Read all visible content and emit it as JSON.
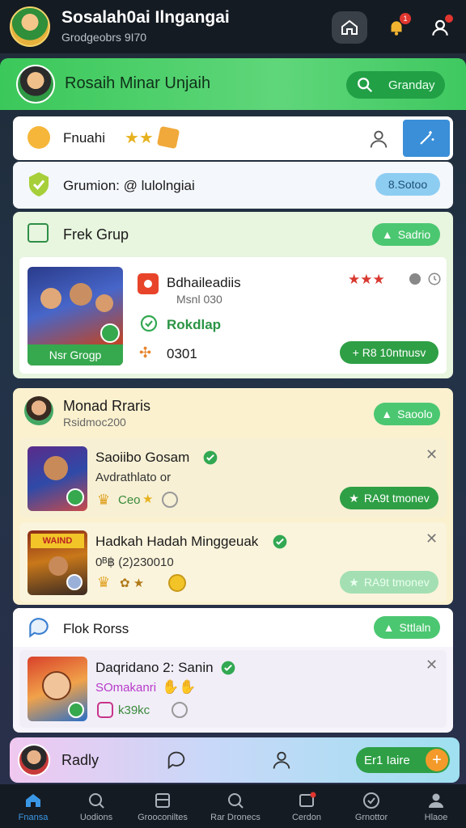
{
  "topbar": {
    "title": "Sosalah0ai Ilngangai",
    "subtitle": "Grodgeobrs 9I70",
    "badge_count": "1"
  },
  "header": {
    "title": "Rosaih Minar Unjaih",
    "button_label": "Granday"
  },
  "card_fnuahi": {
    "label": "Fnuahi"
  },
  "card_grumion": {
    "label": "Grumion: @ lulolngiai",
    "button": "8.Sotoo"
  },
  "frek_grup": {
    "title": "Frek Grup",
    "button": "Sadrio",
    "item": {
      "name": "Bdhaileadiis",
      "meta": "Msnl 030",
      "status": "Rokdlap",
      "count": "0301",
      "thumb_label": "Nsr Grogp",
      "action": "+ R8 10ntnusv"
    }
  },
  "monad": {
    "title": "Monad Rraris",
    "subtitle": "Rsidmoc200",
    "button": "Saoolo",
    "items": [
      {
        "name": "Saoiibo Gosam",
        "meta": "Avdrathlato or",
        "tag": "Ceo",
        "action": "RA9t tmonev"
      },
      {
        "name": "Hadkah Hadah Minggeuak",
        "meta": "0ᴮ฿ (2)230010",
        "action": "RA9t tmonev",
        "thumb_text": "WAIND"
      }
    ]
  },
  "flok": {
    "title": "Flok Rorss",
    "button": "Sttlaln",
    "item": {
      "name": "Daqridano 2: Sanin",
      "meta": "SOmakanri",
      "count": "k39kc"
    }
  },
  "profilebar": {
    "name": "Radly",
    "button": "Er1 Iaire"
  },
  "nav": [
    {
      "label": "Fnansa",
      "icon": "home-icon"
    },
    {
      "label": "Uodions",
      "icon": "search-icon"
    },
    {
      "label": "Grooconiltes",
      "icon": "layers-icon"
    },
    {
      "label": "Rar Dronecs",
      "icon": "search-icon"
    },
    {
      "label": "Cerdon",
      "icon": "message-icon"
    },
    {
      "label": "Grnottor",
      "icon": "check-circle-icon"
    },
    {
      "label": "Hlaoe",
      "icon": "profile-icon"
    }
  ],
  "colors": {
    "accent_green": "#3bc85a",
    "accent_blue": "#3a97e6",
    "badge_red": "#e0362f"
  }
}
